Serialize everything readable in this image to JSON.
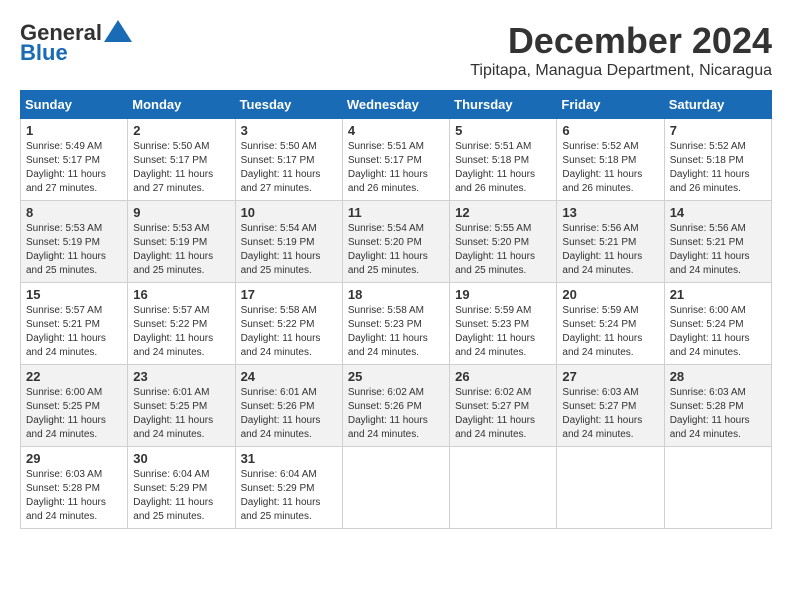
{
  "logo": {
    "general": "General",
    "blue": "Blue"
  },
  "header": {
    "month": "December 2024",
    "location": "Tipitapa, Managua Department, Nicaragua"
  },
  "weekdays": [
    "Sunday",
    "Monday",
    "Tuesday",
    "Wednesday",
    "Thursday",
    "Friday",
    "Saturday"
  ],
  "weeks": [
    [
      {
        "day": "1",
        "sunrise": "5:49 AM",
        "sunset": "5:17 PM",
        "daylight": "11 hours and 27 minutes."
      },
      {
        "day": "2",
        "sunrise": "5:50 AM",
        "sunset": "5:17 PM",
        "daylight": "11 hours and 27 minutes."
      },
      {
        "day": "3",
        "sunrise": "5:50 AM",
        "sunset": "5:17 PM",
        "daylight": "11 hours and 27 minutes."
      },
      {
        "day": "4",
        "sunrise": "5:51 AM",
        "sunset": "5:17 PM",
        "daylight": "11 hours and 26 minutes."
      },
      {
        "day": "5",
        "sunrise": "5:51 AM",
        "sunset": "5:18 PM",
        "daylight": "11 hours and 26 minutes."
      },
      {
        "day": "6",
        "sunrise": "5:52 AM",
        "sunset": "5:18 PM",
        "daylight": "11 hours and 26 minutes."
      },
      {
        "day": "7",
        "sunrise": "5:52 AM",
        "sunset": "5:18 PM",
        "daylight": "11 hours and 26 minutes."
      }
    ],
    [
      {
        "day": "8",
        "sunrise": "5:53 AM",
        "sunset": "5:19 PM",
        "daylight": "11 hours and 25 minutes."
      },
      {
        "day": "9",
        "sunrise": "5:53 AM",
        "sunset": "5:19 PM",
        "daylight": "11 hours and 25 minutes."
      },
      {
        "day": "10",
        "sunrise": "5:54 AM",
        "sunset": "5:19 PM",
        "daylight": "11 hours and 25 minutes."
      },
      {
        "day": "11",
        "sunrise": "5:54 AM",
        "sunset": "5:20 PM",
        "daylight": "11 hours and 25 minutes."
      },
      {
        "day": "12",
        "sunrise": "5:55 AM",
        "sunset": "5:20 PM",
        "daylight": "11 hours and 25 minutes."
      },
      {
        "day": "13",
        "sunrise": "5:56 AM",
        "sunset": "5:21 PM",
        "daylight": "11 hours and 24 minutes."
      },
      {
        "day": "14",
        "sunrise": "5:56 AM",
        "sunset": "5:21 PM",
        "daylight": "11 hours and 24 minutes."
      }
    ],
    [
      {
        "day": "15",
        "sunrise": "5:57 AM",
        "sunset": "5:21 PM",
        "daylight": "11 hours and 24 minutes."
      },
      {
        "day": "16",
        "sunrise": "5:57 AM",
        "sunset": "5:22 PM",
        "daylight": "11 hours and 24 minutes."
      },
      {
        "day": "17",
        "sunrise": "5:58 AM",
        "sunset": "5:22 PM",
        "daylight": "11 hours and 24 minutes."
      },
      {
        "day": "18",
        "sunrise": "5:58 AM",
        "sunset": "5:23 PM",
        "daylight": "11 hours and 24 minutes."
      },
      {
        "day": "19",
        "sunrise": "5:59 AM",
        "sunset": "5:23 PM",
        "daylight": "11 hours and 24 minutes."
      },
      {
        "day": "20",
        "sunrise": "5:59 AM",
        "sunset": "5:24 PM",
        "daylight": "11 hours and 24 minutes."
      },
      {
        "day": "21",
        "sunrise": "6:00 AM",
        "sunset": "5:24 PM",
        "daylight": "11 hours and 24 minutes."
      }
    ],
    [
      {
        "day": "22",
        "sunrise": "6:00 AM",
        "sunset": "5:25 PM",
        "daylight": "11 hours and 24 minutes."
      },
      {
        "day": "23",
        "sunrise": "6:01 AM",
        "sunset": "5:25 PM",
        "daylight": "11 hours and 24 minutes."
      },
      {
        "day": "24",
        "sunrise": "6:01 AM",
        "sunset": "5:26 PM",
        "daylight": "11 hours and 24 minutes."
      },
      {
        "day": "25",
        "sunrise": "6:02 AM",
        "sunset": "5:26 PM",
        "daylight": "11 hours and 24 minutes."
      },
      {
        "day": "26",
        "sunrise": "6:02 AM",
        "sunset": "5:27 PM",
        "daylight": "11 hours and 24 minutes."
      },
      {
        "day": "27",
        "sunrise": "6:03 AM",
        "sunset": "5:27 PM",
        "daylight": "11 hours and 24 minutes."
      },
      {
        "day": "28",
        "sunrise": "6:03 AM",
        "sunset": "5:28 PM",
        "daylight": "11 hours and 24 minutes."
      }
    ],
    [
      {
        "day": "29",
        "sunrise": "6:03 AM",
        "sunset": "5:28 PM",
        "daylight": "11 hours and 24 minutes."
      },
      {
        "day": "30",
        "sunrise": "6:04 AM",
        "sunset": "5:29 PM",
        "daylight": "11 hours and 25 minutes."
      },
      {
        "day": "31",
        "sunrise": "6:04 AM",
        "sunset": "5:29 PM",
        "daylight": "11 hours and 25 minutes."
      },
      null,
      null,
      null,
      null
    ]
  ],
  "labels": {
    "sunrise": "Sunrise:",
    "sunset": "Sunset:",
    "daylight": "Daylight:"
  }
}
